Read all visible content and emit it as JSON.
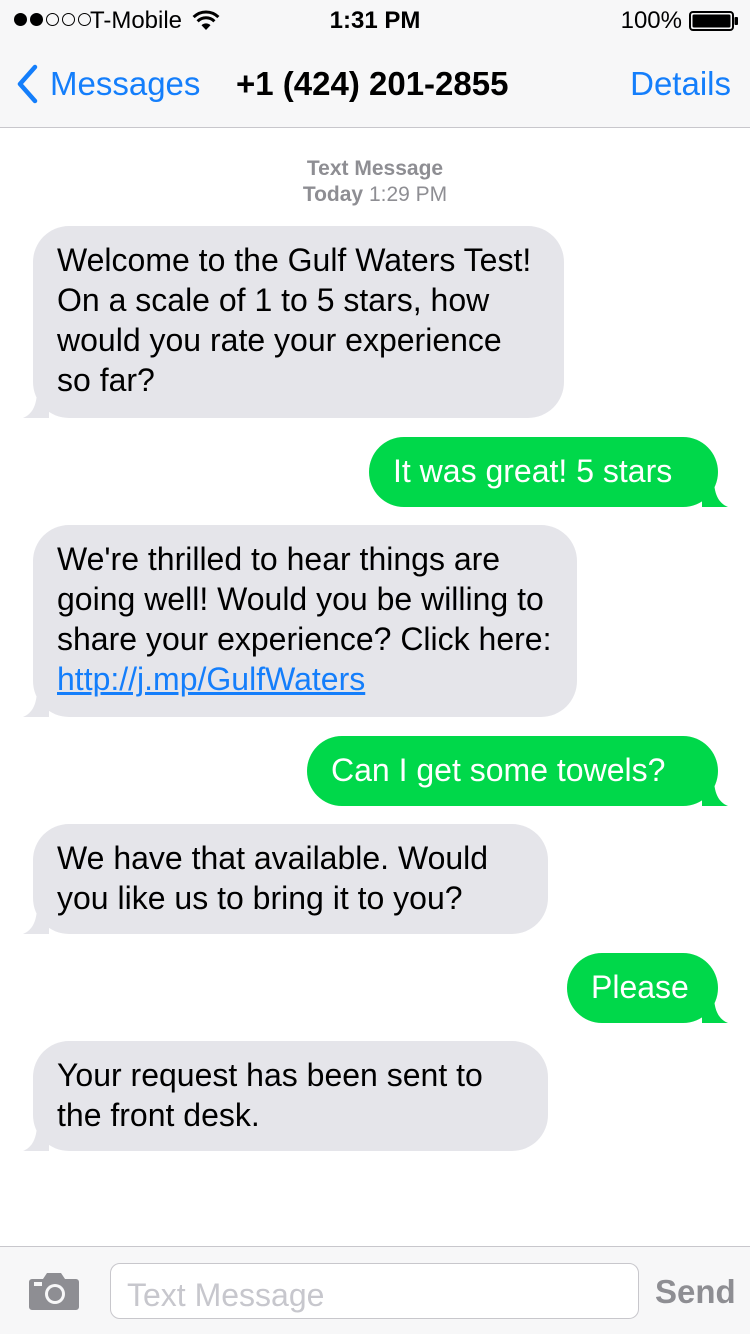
{
  "status_bar": {
    "carrier": "T-Mobile",
    "signal_bars_filled": 2,
    "signal_bars_total": 5,
    "time": "1:31 PM",
    "battery_percent": "100%"
  },
  "nav": {
    "back_label": "Messages",
    "title": "+1 (424) 201-2855",
    "details_label": "Details"
  },
  "thread": {
    "service_label": "Text Message",
    "date_label": "Today",
    "time_label": "1:29 PM"
  },
  "messages": [
    {
      "direction": "incoming",
      "text": "Welcome to the Gulf Waters Test! On a scale of 1 to 5 stars, how would you rate your experience so far?"
    },
    {
      "direction": "outgoing",
      "text": "It was great! 5 stars"
    },
    {
      "direction": "incoming",
      "text": "We're thrilled to hear things are going well! Would you be willing to share your experience? Click here:",
      "link": "http://j.mp/GulfWaters"
    },
    {
      "direction": "outgoing",
      "text": "Can I get some towels?"
    },
    {
      "direction": "incoming",
      "text": "We have that available. Would you like us to bring it to you?"
    },
    {
      "direction": "outgoing",
      "text": "Please"
    },
    {
      "direction": "incoming",
      "text": "Your request has been sent to the front desk."
    }
  ],
  "composer": {
    "placeholder": "Text Message",
    "send_label": "Send"
  },
  "colors": {
    "accent": "#147efb",
    "incoming_bubble": "#e5e5ea",
    "outgoing_bubble": "#00d84a",
    "meta_text": "#8e8e93"
  },
  "icons": {
    "back": "chevron-left-icon",
    "wifi": "wifi-icon",
    "battery": "battery-icon",
    "camera": "camera-icon"
  }
}
